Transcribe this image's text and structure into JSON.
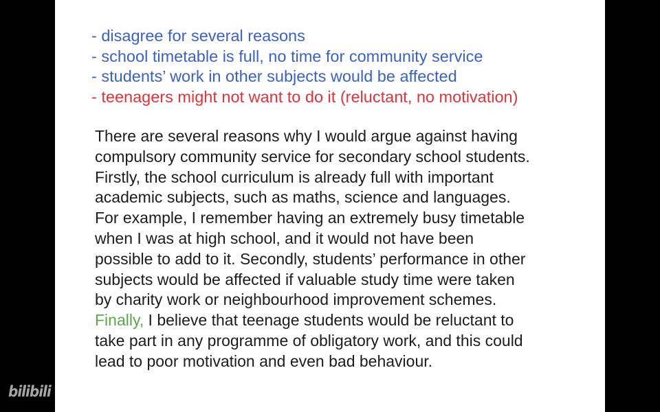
{
  "bullets": [
    {
      "text": "- disagree for several reasons",
      "color": "#3a62c6"
    },
    {
      "text": "- school timetable is full, no time for community service",
      "color": "#3a62c6"
    },
    {
      "text": "- students’ work in other subjects would be affected",
      "color": "#3a62c6"
    },
    {
      "text": "- teenagers might not want to do it (reluctant, no motivation)",
      "color": "#e0343a"
    }
  ],
  "paragraph": {
    "lines": [
      "There are several reasons why I would argue against having",
      "compulsory community service for secondary school students.",
      "Firstly, the school curriculum is already full with important",
      "academic subjects, such as maths, science and languages.",
      "For example, I remember having an extremely busy timetable",
      "when I was at high school, and it would not have been",
      "possible to add to it. Secondly, students’ performance in other",
      "subjects would be affected if valuable study time were taken",
      "by charity work or neighbourhood improvement schemes."
    ],
    "highlight_word": "Finally,",
    "highlight_color": "#5aa84a",
    "highlight_rest": " I believe that teenage students would be reluctant to",
    "tail_lines": [
      "take part in any programme of obligatory work, and this could",
      "lead to poor motivation and even bad behaviour."
    ]
  },
  "watermark": "bilibili"
}
